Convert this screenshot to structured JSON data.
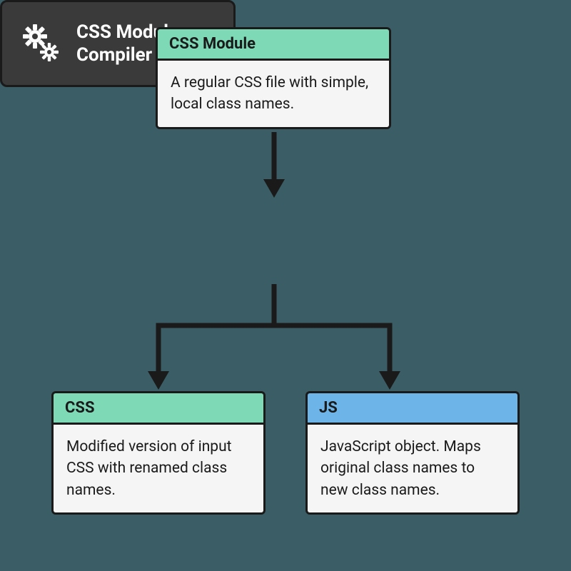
{
  "diagram": {
    "top": {
      "title": "CSS Module",
      "body": "A regular CSS file with simple, local class names."
    },
    "compiler": {
      "title": "CSS Modules Compiler"
    },
    "css": {
      "title": "CSS",
      "body": "Modified version of input CSS with renamed class names."
    },
    "js": {
      "title": "JS",
      "body": "JavaScript object. Maps original class names to new class names."
    }
  },
  "colors": {
    "green": "#7ed9b7",
    "blue": "#6db4e8",
    "dark": "#3a3a3a",
    "bg": "#3b5e66"
  }
}
